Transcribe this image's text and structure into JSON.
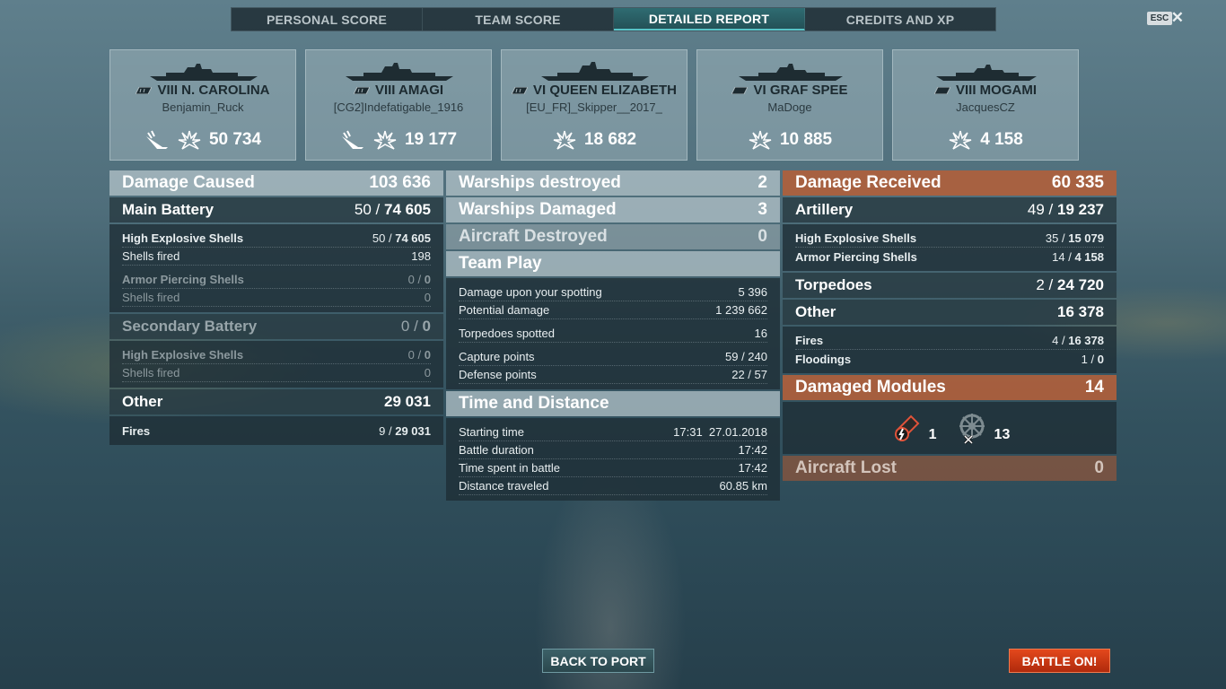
{
  "tabs": [
    {
      "label": "PERSONAL SCORE"
    },
    {
      "label": "TEAM SCORE"
    },
    {
      "label": "DETAILED REPORT"
    },
    {
      "label": "CREDITS AND XP"
    }
  ],
  "esc_label": "ESC",
  "close_glyph": "✕",
  "ships": [
    {
      "name": "VIII N. CAROLINA",
      "player": "Benjamin_Ruck",
      "damage": "50 734",
      "has_sunk_icon": true
    },
    {
      "name": "VIII AMAGI",
      "player": "[CG2]Indefatigable_1916",
      "damage": "19 177",
      "has_sunk_icon": true
    },
    {
      "name": "VI QUEEN ELIZABETH",
      "player": "[EU_FR]_Skipper__2017_",
      "damage": "18 682",
      "has_sunk_icon": false
    },
    {
      "name": "VI GRAF SPEE",
      "player": "MaDoge",
      "damage": "10 885",
      "has_sunk_icon": false
    },
    {
      "name": "VIII MOGAMI",
      "player": "JacquesCZ",
      "damage": "4 158",
      "has_sunk_icon": false
    }
  ],
  "damage_caused": {
    "title": "Damage Caused",
    "value": "103 636",
    "main_battery": {
      "label": "Main Battery",
      "hits": "50",
      "sep": "/",
      "dmg": "74 605"
    },
    "main_he": {
      "label": "High Explosive Shells",
      "hits": "50",
      "sep": "/",
      "dmg": "74 605"
    },
    "main_he_fired": {
      "label": "Shells fired",
      "value": "198"
    },
    "main_ap": {
      "label": "Armor Piercing Shells",
      "hits": "0",
      "sep": "/",
      "dmg": "0"
    },
    "main_ap_fired": {
      "label": "Shells fired",
      "value": "0"
    },
    "secondary": {
      "label": "Secondary Battery",
      "hits": "0",
      "sep": "/",
      "dmg": "0"
    },
    "sec_he": {
      "label": "High Explosive Shells",
      "hits": "0",
      "sep": "/",
      "dmg": "0"
    },
    "sec_fired": {
      "label": "Shells fired",
      "value": "0"
    },
    "other": {
      "label": "Other",
      "value": "29 031"
    },
    "fires": {
      "label": "Fires",
      "hits": "9",
      "sep": "/",
      "dmg": "29 031"
    }
  },
  "middle": {
    "warships_destroyed": {
      "label": "Warships destroyed",
      "value": "2"
    },
    "warships_damaged": {
      "label": "Warships Damaged",
      "value": "3"
    },
    "aircraft_destroyed": {
      "label": "Aircraft Destroyed",
      "value": "0"
    },
    "team_play": {
      "title": "Team Play",
      "rows": [
        {
          "label": "Damage upon your spotting",
          "value": "5 396"
        },
        {
          "label": "Potential damage",
          "value": "1 239 662"
        },
        {
          "label": "Torpedoes spotted",
          "value": "16"
        },
        {
          "label": "Capture points",
          "value": "59 / 240"
        },
        {
          "label": "Defense points",
          "value": "22 / 57"
        }
      ]
    },
    "time_distance": {
      "title": "Time and Distance",
      "rows": [
        {
          "label": "Starting time",
          "value": "17:31  27.01.2018"
        },
        {
          "label": "Battle duration",
          "value": "17:42"
        },
        {
          "label": "Time spent in battle",
          "value": "17:42"
        },
        {
          "label": "Distance traveled",
          "value": "60.85 km"
        }
      ]
    }
  },
  "damage_received": {
    "title": "Damage Received",
    "value": "60 335",
    "artillery": {
      "label": "Artillery",
      "hits": "49",
      "sep": "/",
      "dmg": "19 237"
    },
    "art_he": {
      "label": "High Explosive Shells",
      "hits": "35",
      "sep": "/",
      "dmg": "15 079"
    },
    "art_ap": {
      "label": "Armor Piercing Shells",
      "hits": "14",
      "sep": "/",
      "dmg": "4 158"
    },
    "torpedoes": {
      "label": "Torpedoes",
      "hits": "2",
      "sep": "/",
      "dmg": "24 720"
    },
    "other": {
      "label": "Other",
      "value": "16 378"
    },
    "fires": {
      "label": "Fires",
      "hits": "4",
      "sep": "/",
      "dmg": "16 378"
    },
    "floodings": {
      "label": "Floodings",
      "hits": "1",
      "sep": "/",
      "dmg": "0"
    },
    "damaged_modules": {
      "label": "Damaged Modules",
      "value": "14"
    },
    "modules": [
      {
        "icon": "engine-module-icon",
        "count": "1"
      },
      {
        "icon": "steering-module-icon",
        "count": "13"
      }
    ],
    "aircraft_lost": {
      "label": "Aircraft Lost",
      "value": "0"
    }
  },
  "buttons": {
    "back_to_port": "BACK TO PORT",
    "battle_on": "BATTLE ON!"
  },
  "colors": {
    "active_tab": "#58c3c7",
    "received_header": "#af5f3c",
    "battle_button": "#e3481c"
  }
}
